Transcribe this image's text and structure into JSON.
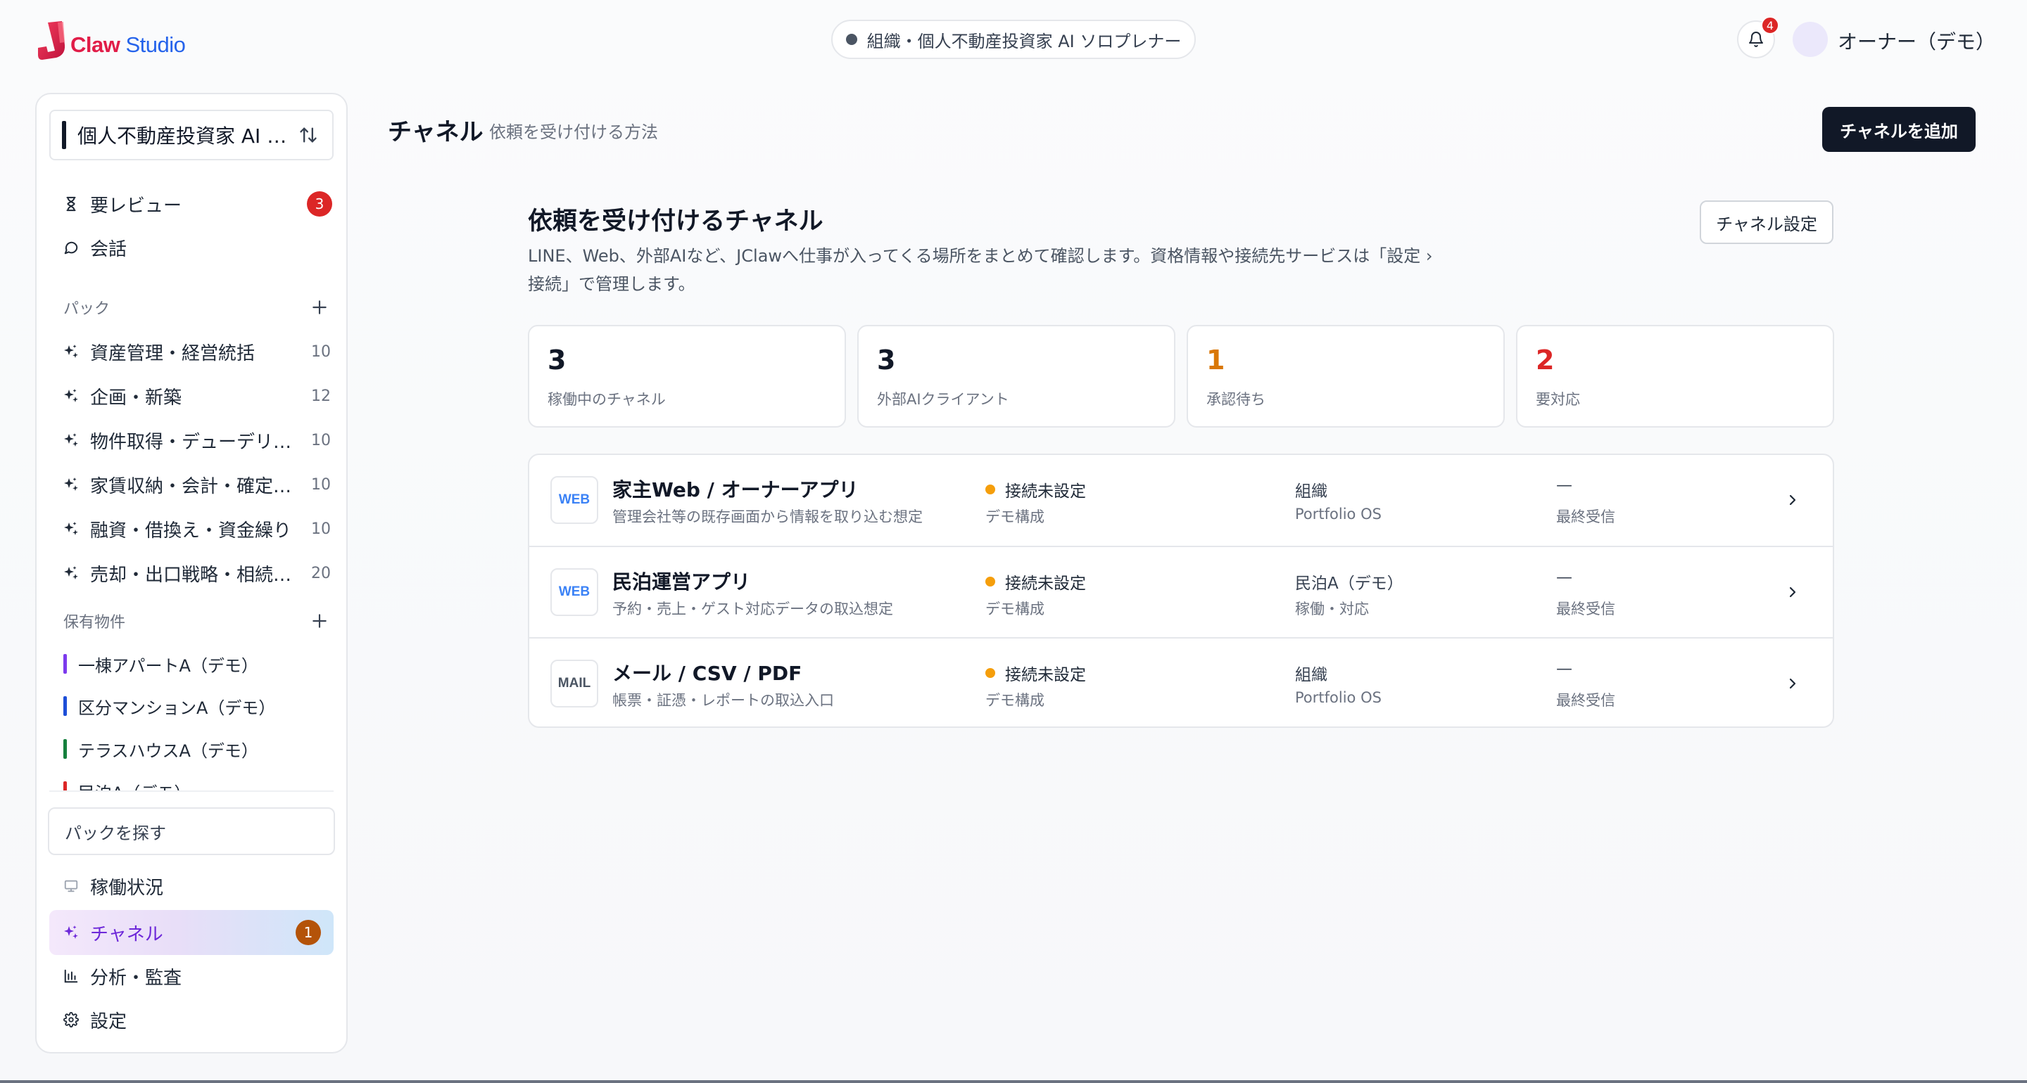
{
  "brand": {
    "claw": "Claw",
    "studio": "Studio"
  },
  "header": {
    "org": "組織・個人不動産投資家 AI ソロプレナー",
    "notifications": "4",
    "user": "オーナー（デモ）"
  },
  "sidebar": {
    "workspace": "個人不動産投資家 AI ソロプレナー",
    "review": {
      "label": "要レビュー",
      "badge": "3"
    },
    "chat": "会話",
    "packs_heading": "パック",
    "packs": [
      {
        "label": "資産管理・経営統括",
        "count": "10"
      },
      {
        "label": "企画・新築",
        "count": "12"
      },
      {
        "label": "物件取得・デューデリジェンス",
        "count": "10"
      },
      {
        "label": "家賃収納・会計・確定申告",
        "count": "10"
      },
      {
        "label": "融資・借換え・資金繰り",
        "count": "10"
      },
      {
        "label": "売却・出口戦略・相続対策",
        "count": "20"
      }
    ],
    "properties_heading": "保有物件",
    "properties": [
      {
        "label": "一棟アパートA（デモ）",
        "color": "#7c3aed"
      },
      {
        "label": "区分マンションA（デモ）",
        "color": "#1d4ed8"
      },
      {
        "label": "テラスハウスA（デモ）",
        "color": "#15803d"
      },
      {
        "label": "民泊A（デモ）",
        "color": "#dc2626"
      }
    ],
    "pack_search": "パックを探す",
    "status": "稼働状況",
    "channels": {
      "label": "チャネル",
      "badge": "1"
    },
    "analytics": "分析・監査",
    "settings": "設定"
  },
  "main": {
    "title": "チャネル",
    "subtitle": "依頼を受け付ける方法",
    "add_button": "チャネルを追加",
    "section_title": "依頼を受け付けるチャネル",
    "section_desc": "LINE、Web、外部AIなど、JClawへ仕事が入ってくる場所をまとめて確認します。資格情報や接続先サービスは「設定 › 接続」で管理します。",
    "settings_button": "チャネル設定",
    "stats": [
      {
        "value": "3",
        "label": "稼働中のチャネル",
        "color": "#111827"
      },
      {
        "value": "3",
        "label": "外部AIクライアント",
        "color": "#111827"
      },
      {
        "value": "1",
        "label": "承認待ち",
        "color": "#d97706"
      },
      {
        "value": "2",
        "label": "要対応",
        "color": "#dc2626"
      }
    ],
    "channels": [
      {
        "tag": "WEB",
        "tag_color": "#3b82f6",
        "name": "家主Web / オーナーアプリ",
        "desc": "管理会社等の既存画面から情報を取り込む想定",
        "status": "接続未設定",
        "config": "デモ構成",
        "scope": "組織",
        "scope_sub": "Portfolio OS",
        "last": "—",
        "last_label": "最終受信"
      },
      {
        "tag": "WEB",
        "tag_color": "#3b82f6",
        "name": "民泊運営アプリ",
        "desc": "予約・売上・ゲスト対応データの取込想定",
        "status": "接続未設定",
        "config": "デモ構成",
        "scope": "民泊A（デモ）",
        "scope_sub": "稼働・対応",
        "last": "—",
        "last_label": "最終受信"
      },
      {
        "tag": "MAIL",
        "tag_color": "#4b5563",
        "name": "メール / CSV / PDF",
        "desc": "帳票・証憑・レポートの取込入口",
        "status": "接続未設定",
        "config": "デモ構成",
        "scope": "組織",
        "scope_sub": "Portfolio OS",
        "last": "—",
        "last_label": "最終受信"
      }
    ]
  }
}
